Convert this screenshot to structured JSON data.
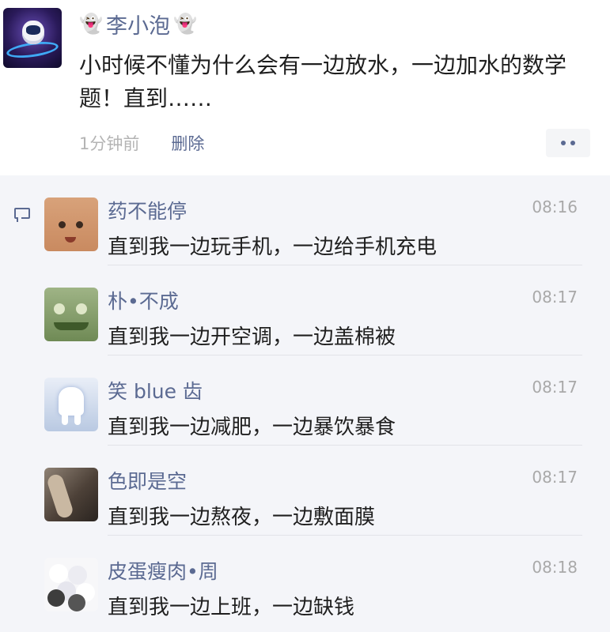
{
  "post": {
    "author": "李小泡",
    "author_emoji_left": "👻",
    "author_emoji_right": "👻",
    "text": "小时候不懂为什么会有一边放水，一边加水的数学题！直到……",
    "time": "1分钟前",
    "delete_label": "删除",
    "more_icon": "more-dots-icon"
  },
  "comments": [
    {
      "name": "药不能停",
      "text": "直到我一边玩手机，一边给手机充电",
      "time": "08:16"
    },
    {
      "name": "朴•不成",
      "text": "直到我一边开空调，一边盖棉被",
      "time": "08:17"
    },
    {
      "name": "笑 blue 齿",
      "text": "直到我一边减肥，一边暴饮暴食",
      "time": "08:17"
    },
    {
      "name": "色即是空",
      "text": "直到我一边熬夜，一边敷面膜",
      "time": "08:17"
    },
    {
      "name": "皮蛋瘦肉•周",
      "text": "直到我一边上班，一边缺钱",
      "time": "08:18"
    }
  ],
  "colors": {
    "link": "#5b6a92",
    "comment_bg": "#f4f5f9",
    "meta_gray": "#b4b4b4"
  }
}
